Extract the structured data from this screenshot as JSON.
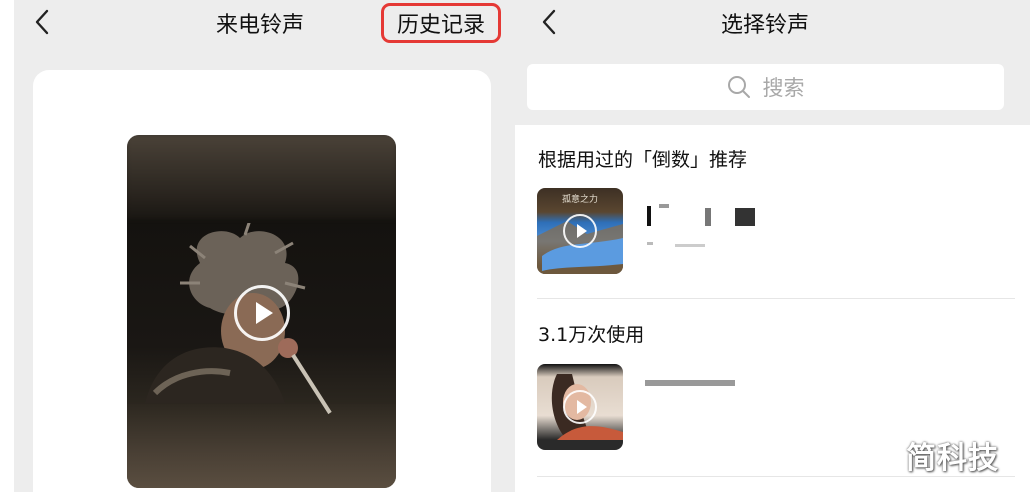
{
  "left": {
    "title": "来电铃声",
    "history_button": "历史记录"
  },
  "right": {
    "title": "选择铃声",
    "search_placeholder": "搜索",
    "sections": [
      {
        "heading": "根据用过的「倒数」推荐",
        "thumb_caption": "孤意之力"
      },
      {
        "heading": "3.1万次使用"
      }
    ]
  },
  "watermark": "简科技",
  "colors": {
    "highlight": "#e53935",
    "bg": "#ededed"
  }
}
